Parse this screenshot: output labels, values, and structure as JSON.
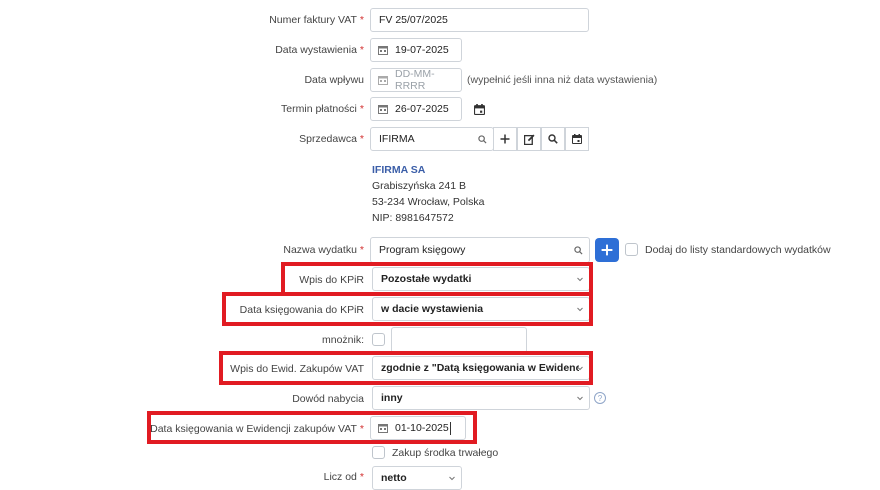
{
  "form": {
    "invoice_number": {
      "label": "Numer faktury VAT",
      "required": "*",
      "value": "FV 25/07/2025"
    },
    "issue_date": {
      "label": "Data wystawienia",
      "required": "*",
      "value": "19-07-2025"
    },
    "receipt_date": {
      "label": "Data wpływu",
      "placeholder": "DD-MM-RRRR",
      "hint": "(wypełnić jeśli inna niż data wystawienia)"
    },
    "payment_due": {
      "label": "Termin płatności",
      "required": "*",
      "value": "26-07-2025"
    },
    "seller": {
      "label": "Sprzedawca",
      "required": "*",
      "value": "IFIRMA",
      "details": {
        "name": "IFIRMA SA",
        "street": "Grabiszyńska 241 B",
        "city": "53-234 Wrocław, Polska",
        "nip": "NIP: 8981647572"
      }
    },
    "expense_name": {
      "label": "Nazwa wydatku",
      "required": "*",
      "value": "Program księgowy",
      "add_to_list_label": "Dodaj do listy standardowych wydatków"
    },
    "kpir_entry": {
      "label": "Wpis do KPiR",
      "value": "Pozostałe wydatki"
    },
    "kpir_booking_date": {
      "label": "Data księgowania do KPiR",
      "value": "w dacie wystawienia"
    },
    "multiplier": {
      "label": "mnożnik:"
    },
    "vat_purchase_register": {
      "label": "Wpis do Ewid. Zakupów VAT",
      "value": "zgodnie z \"Datą księgowania w Ewidencji zaku"
    },
    "acquisition_proof": {
      "label": "Dowód nabycia",
      "value": "inny"
    },
    "vat_booking_date": {
      "label": "Data księgowania w Ewidencji zakupów VAT",
      "required": "*",
      "value": "01-10-2025"
    },
    "fixed_asset": {
      "label": "Zakup środka trwałego"
    },
    "calc_from": {
      "label": "Licz od",
      "required": "*",
      "value": "netto"
    }
  },
  "colors": {
    "highlight": "#e11b22",
    "accent": "#2e6fd6",
    "seller_name": "#3b5ea8"
  }
}
